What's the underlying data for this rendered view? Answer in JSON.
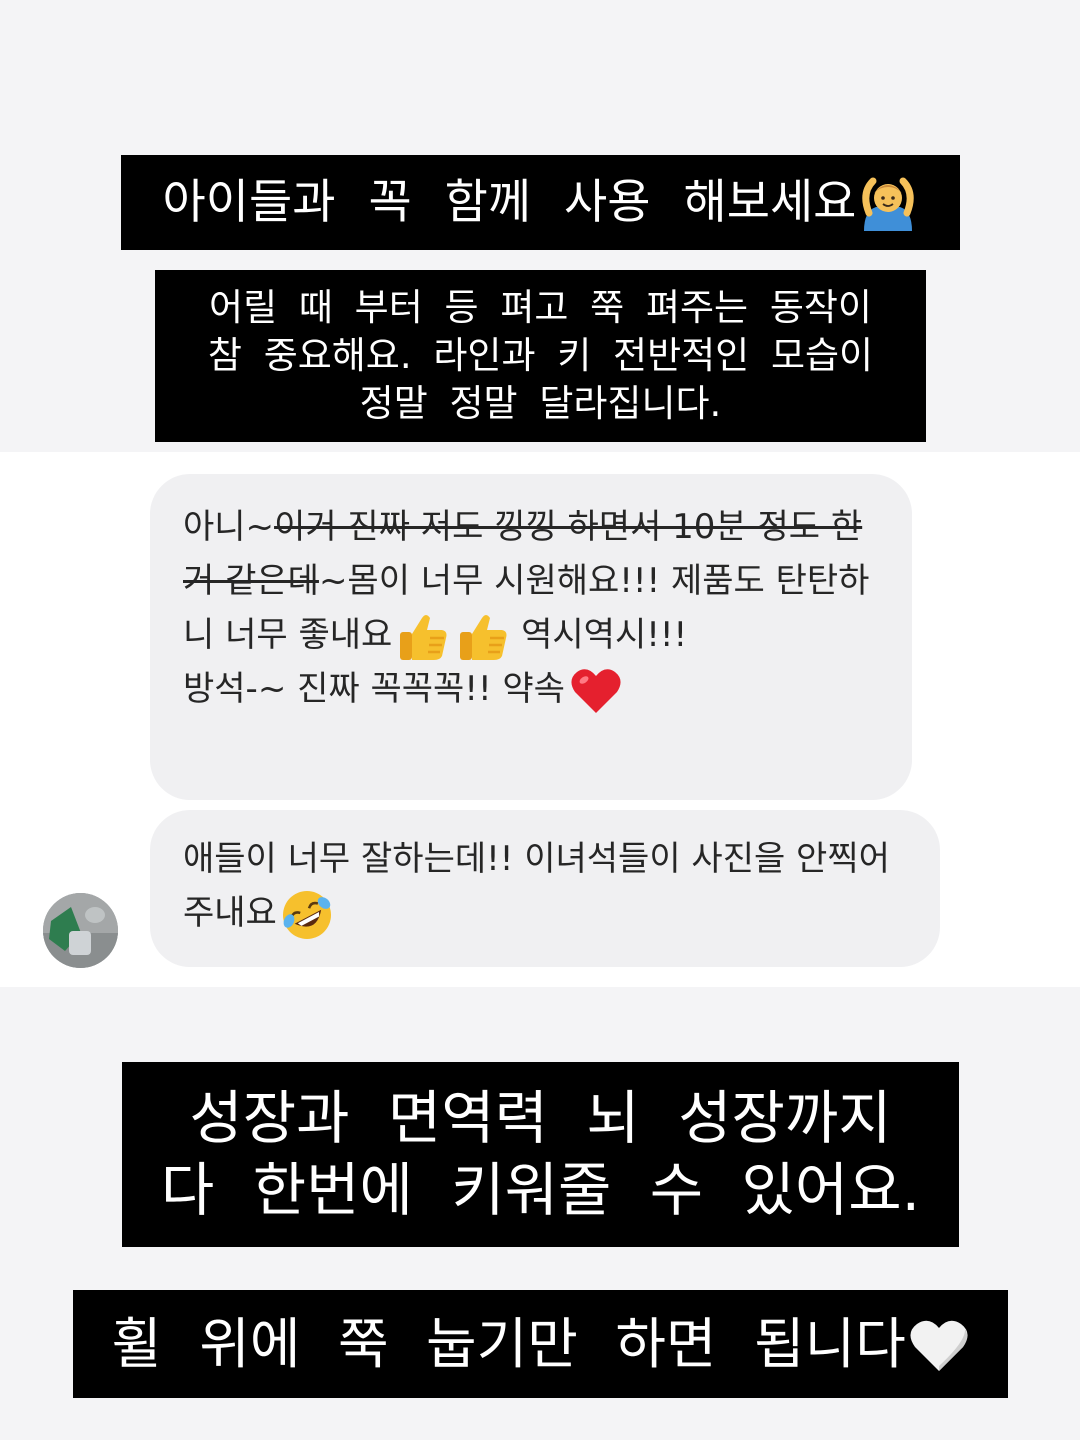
{
  "caption_top": "아이들과 꼭 함께 사용 해보세요",
  "caption_intro": {
    "line1": "어릴 때 부터 등 펴고 쭉 펴주는 동작이",
    "line2": "참 중요해요. 라인과 키 전반적인 모습이",
    "line3": "정말 정말 달라집니다."
  },
  "message_1": {
    "prefix": "아니~",
    "strikethrough": "이거 진짜 저도 낑낑 하면서 10분 정도 한거 같은데",
    "text_after_strike": "~몸이 너무 시원해요!!! 제품도 탄탄하니 너무 좋내요",
    "text_after_thumbs": " 역시역시!!!",
    "line_2": "방석-~ 진짜  꼭꼭꼭!!  약속"
  },
  "message_2": {
    "text": "애들이 너무 잘하는데!! 이녀석들이 사진을 안찍어주내요"
  },
  "caption_growth": {
    "line1": "성장과 면역력 뇌 성장까지",
    "line2": "다 한번에 키워줄 수 있어요."
  },
  "caption_bottom": "휠 위에 쭉 눕기만 하면 됩니다",
  "icons": {
    "caption_top": "person-gesturing-ok-emoji",
    "message_1_a": "thumbs-up-emoji",
    "message_1_b": "thumbs-up-emoji",
    "message_1_end": "red-heart-emoji",
    "message_2_end": "rolling-on-floor-laughing-emoji",
    "caption_bottom": "white-heart-emoji",
    "avatar": "sender-avatar"
  },
  "colors": {
    "caption_bg": "#000000",
    "caption_text": "#ffffff",
    "bubble_bg": "#f0f0f2",
    "message_text": "#262626"
  }
}
